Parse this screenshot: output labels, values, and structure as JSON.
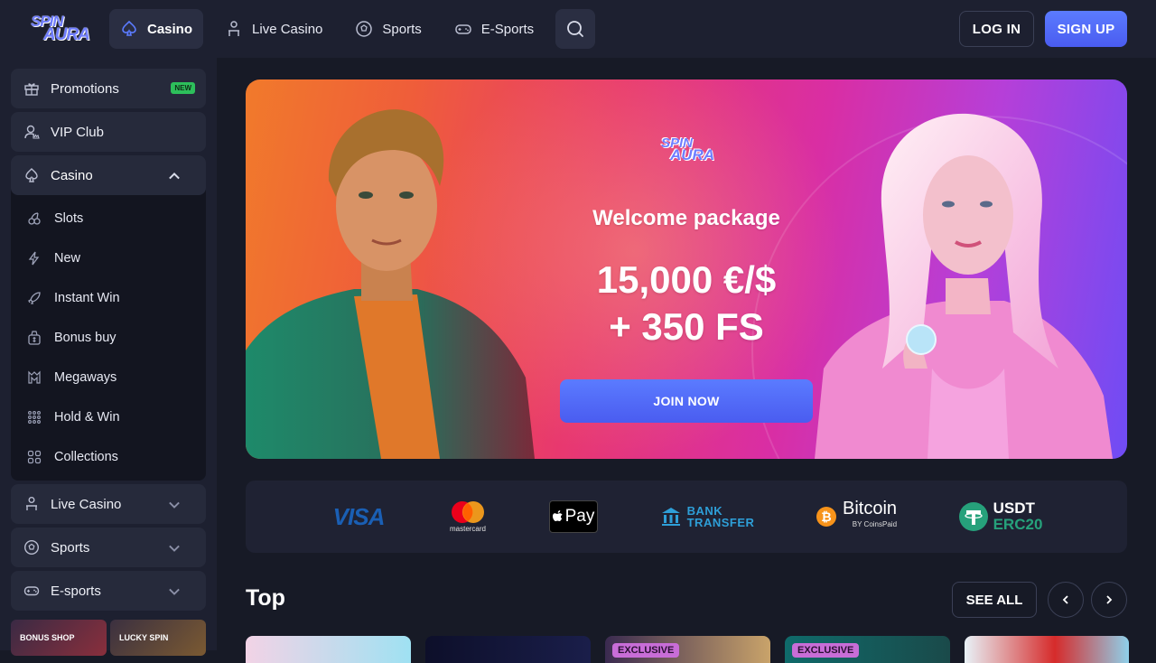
{
  "brand": {
    "logo_line1": "SPIN",
    "logo_line2": "AURA"
  },
  "topnav": {
    "items": [
      {
        "label": "Casino",
        "icon": "spade-icon"
      },
      {
        "label": "Live Casino",
        "icon": "dealer-icon"
      },
      {
        "label": "Sports",
        "icon": "soccer-ball-icon"
      },
      {
        "label": "E-Sports",
        "icon": "gamepad-icon"
      }
    ],
    "login": "LOG IN",
    "signup": "SIGN UP"
  },
  "sidebar": {
    "promotions": {
      "label": "Promotions",
      "badge": "NEW"
    },
    "vip": {
      "label": "VIP Club"
    },
    "casino": {
      "label": "Casino",
      "items": [
        {
          "label": "Slots"
        },
        {
          "label": "New"
        },
        {
          "label": "Instant Win"
        },
        {
          "label": "Bonus buy"
        },
        {
          "label": "Megaways"
        },
        {
          "label": "Hold & Win"
        },
        {
          "label": "Collections"
        }
      ]
    },
    "live_casino": {
      "label": "Live Casino"
    },
    "sports": {
      "label": "Sports"
    },
    "esports": {
      "label": "E-sports"
    },
    "thumbs": [
      {
        "label": "BONUS SHOP"
      },
      {
        "label": "LUCKY SPIN"
      }
    ]
  },
  "hero": {
    "logo_line1": "SPIN",
    "logo_line2": "AURA",
    "title": "Welcome package",
    "amount_line1": "15,000 €/$",
    "amount_line2": "+ 350 FS",
    "cta": "JOIN NOW"
  },
  "payments": {
    "visa": "VISA",
    "mastercard": "mastercard",
    "applepay": "Pay",
    "bank_line1": "BANK",
    "bank_line2": "TRANSFER",
    "bitcoin": "Bitcoin",
    "bitcoin_sub": "BY CoinsPaid",
    "usdt_line1": "USDT",
    "usdt_line2": "ERC20"
  },
  "top_section": {
    "title": "Top",
    "see_all": "SEE ALL",
    "exclusive_badge": "EXCLUSIVE"
  },
  "colors": {
    "accent": "#4f63f5",
    "background": "#171a26",
    "panel": "#1d2030",
    "new_badge": "#2dbf5b"
  }
}
